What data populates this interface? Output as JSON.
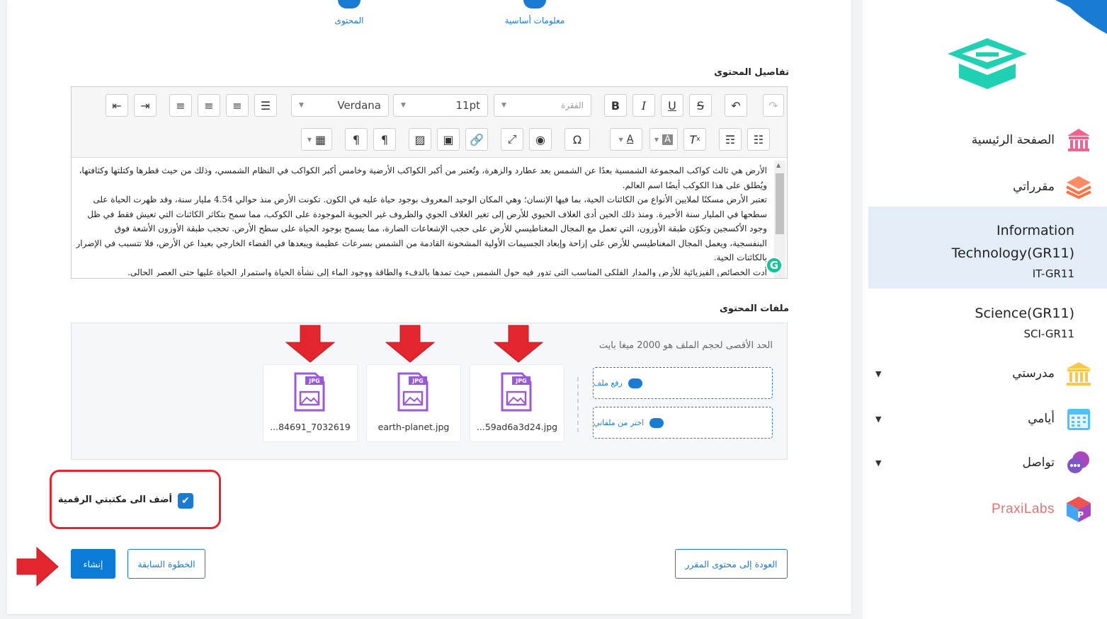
{
  "steps": {
    "content": "المحتوى",
    "basic_info": "معلومات أساسية"
  },
  "content_details_label": "تفاصيل المحتوى",
  "editor": {
    "font_family": "Verdana",
    "font_size": "11pt",
    "paragraph_placeholder": "الفقرة",
    "paragraphs": [
      "الأرض هي ثالث كواكب المجموعة الشمسية بعدًا عن الشمس بعد عطارد والزهرة، وتُعتبر من أكبر الكواكب الأرضية وخامس أكبر الكواكب في النظام الشمسي، وذلك من حيث قطرها وكتلتها وكثافتها، ويُطلق على هذا الكوكب أيضًا اسم العالم.",
      "تعتبر الأرض مسكنًا لملايين الأنواع من الكائنات الحية، بما فيها الإنسان؛ وهي المكان الوحيد المعروف بوجود حياة عليه في الكون. تكونت الأرض منذ حوالي 4.54 مليار سنة، وقد ظهرت الحياة على سطحها في المليار سنة الأخيرة. ومنذ ذلك الحين أدى الغلاف الحيوي للأرض إلى تغير الغلاف الجوي والظروف غير الحيوية الموجودة على الكوكب، مما سمح بتكاثر الكائنات التي تعيش فقط في ظل وجود الأكسجين وتكوّن طبقة الأوزون، التي تعمل مع المجال المغناطيسي للأرض على حجب الإشعاعات الضارة، مما يسمح بوجود الحياة على سطح الأرض. تحجب طبقة الأوزون الأشعة فوق البنفسجية، ويعمل المجال المغناطيسي للأرض على إزاحة وإبعاد الجسيمات الأولية المشحونة القادمة من الشمس بسرعات عظيمة ويبعدها في الفضاء الخارجي بعيدا عن الأرض، فلا تتسبب في الإضرار بالكائنات الحية.",
      "أدت الخصائص الفيزيائية للأرض والمدار الفلكي المناسب التي تدور فيه حول الشمس حيث تمدها بالدفء والطاقة ووجود الماء إلى نشأة الحياة واستمرار الحياة عليها حتى العصر الحالي."
    ]
  },
  "files_label": "ملفات المحتوى",
  "files": {
    "max_size_note": "الحد الأقصى لحجم الملف هو 2000 ميغا بايت",
    "upload_label": "رفع ملف",
    "choose_label": "اختر من ملفاتي",
    "badge": "JPG",
    "items": [
      {
        "name": "...59ad6a3d24.jpg"
      },
      {
        "name": "earth-planet.jpg"
      },
      {
        "name": "...84691_7032619"
      }
    ]
  },
  "add_to_library_label": "أضف الى مكتبتي الرقمية",
  "buttons": {
    "create": "إنشاء",
    "previous": "الخطوة السابقة",
    "back_to_course": "العودة إلى محتوى المقرر"
  },
  "sidebar": {
    "home": "الصفحة الرئيسية",
    "courses": "مقرراتي",
    "course_1": {
      "title_line1": "Information",
      "title_line2": "Technology(GR11)",
      "code": "IT-GR11"
    },
    "course_2": {
      "title": "Science(GR11)",
      "code": "SCI-GR11"
    },
    "school": "مدرستي",
    "days": "أيامي",
    "contact": "تواصل",
    "praxilabs": "PraxiLabs"
  },
  "colors": {
    "accent": "#1a7bd3",
    "highlight_red": "#e3262d",
    "logo_teal": "#1fd1b2",
    "file_purple": "#9b59d6"
  }
}
